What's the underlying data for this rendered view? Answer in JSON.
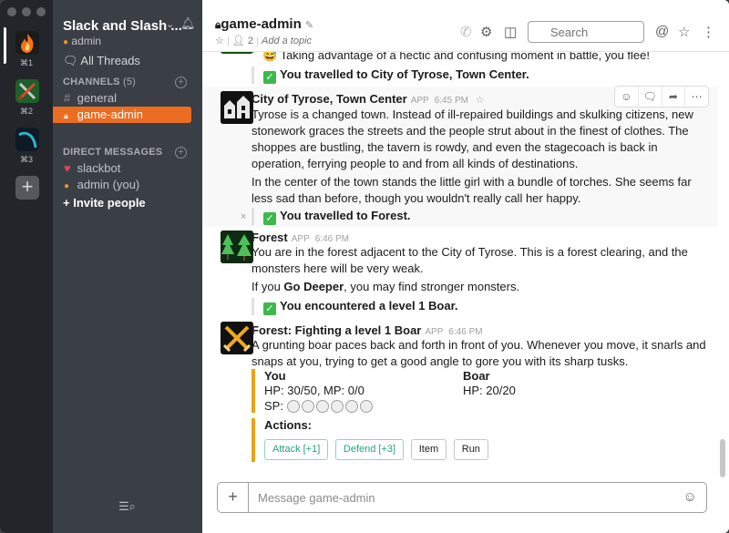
{
  "teams": [
    {
      "key": "⌘1"
    },
    {
      "key": "⌘2"
    },
    {
      "key": "⌘3"
    }
  ],
  "sidebar": {
    "workspace_name": "Slack and Slash ...",
    "user": "admin",
    "all_threads": "All Threads",
    "channels_header": "CHANNELS",
    "channels_count": "(5)",
    "channels": [
      {
        "prefix": "#",
        "label": "general"
      },
      {
        "prefix": "🔒",
        "label": "game-admin"
      }
    ],
    "dm_header": "DIRECT MESSAGES",
    "dms": [
      {
        "label": "slackbot"
      },
      {
        "label": "admin (you)"
      }
    ],
    "invite": "+ Invite people"
  },
  "header": {
    "channel": "game-admin",
    "members": "2",
    "topic": "Add a topic",
    "search_placeholder": "Search"
  },
  "messages": {
    "top_partial": "😅 Taking advantage of a hectic and confusing moment in battle, you flee!",
    "top_result": "You travelled to City of Tyrose, Town Center.",
    "tyrose": {
      "sender": "City of Tyrose, Town Center",
      "app": "APP",
      "time": "6:45 PM",
      "p1": "Tyrose is a changed town.  Instead of ill-repaired buildings and skulking citizens, new stonework graces the streets and the people strut about in the finest of clothes.  The shoppes are bustling, the tavern is rowdy, and even the stagecoach is back in operation, ferrying people to and from all kinds of destinations.",
      "p2": "In the center of the town stands the little girl with a bundle of torches.  She seems far less sad than before, though you wouldn't really call her happy.",
      "result": "You travelled to Forest."
    },
    "forest": {
      "sender": "Forest",
      "app": "APP",
      "time": "6:46 PM",
      "p1": "You are in the forest adjacent to the City of Tyrose. This is a forest clearing, and the monsters here will be very weak.",
      "p2_pre": "If you ",
      "p2_bold": "Go Deeper",
      "p2_post": ", you may find stronger monsters.",
      "result": "You encountered a level 1 Boar."
    },
    "fight": {
      "sender": "Forest: Fighting a level 1 Boar",
      "app": "APP",
      "time": "6:46 PM",
      "p1": "A grunting boar paces back and forth in front of you. Whenever you move, it snarls and snaps at you, trying to get a good angle to gore you with its sharp tusks.",
      "you_label": "You",
      "you_stats": "HP: 30/50, MP: 0/0",
      "sp_label": "SP:",
      "sp_filled": 0,
      "sp_total": 6,
      "boar_label": "Boar",
      "boar_stats": "HP: 20/20",
      "actions_label": "Actions:",
      "buttons": [
        "Attack [+1]",
        "Defend [+3]",
        "Item",
        "Run"
      ]
    }
  },
  "composer": {
    "placeholder": "Message game-admin"
  },
  "colors": {
    "sidebar_bg": "#3a3e45",
    "switcher_bg": "#22262a",
    "active_channel": "#eb6d22",
    "attachment_bar": "#e8a319",
    "success": "#3db84a"
  }
}
